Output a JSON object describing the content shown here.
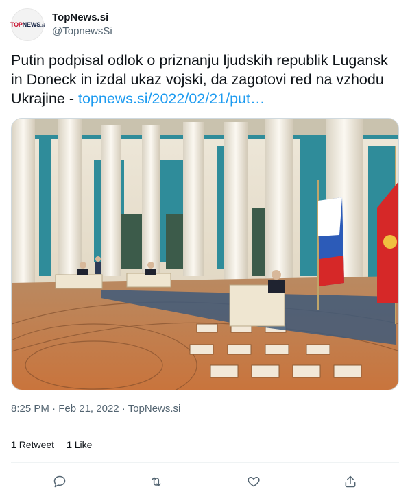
{
  "account": {
    "display_name": "TopNews.si",
    "handle": "@TopnewsSi",
    "avatar_brand_top": "TOP",
    "avatar_brand_news": "NEWS",
    "avatar_brand_si": ".si"
  },
  "tweet": {
    "text": "Putin podpisal odlok o priznanju ljudskih republik Lugansk in Doneck in izdal ukaz vojski, da zagotovi red na vzhodu Ukrajine - ",
    "link_text": "topnews.si/2022/02/21/put…",
    "media_description_icon": "photo"
  },
  "meta": {
    "time": "8:25 PM",
    "separator": " · ",
    "date": "Feb 21, 2022",
    "source": "TopNews.si"
  },
  "stats": {
    "retweets_count": "1",
    "retweets_label": "Retweet",
    "likes_count": "1",
    "likes_label": "Like"
  },
  "actions": {
    "reply_icon": "reply-icon",
    "retweet_icon": "retweet-icon",
    "like_icon": "like-icon",
    "share_icon": "share-icon"
  },
  "colors": {
    "link": "#1d9bf0",
    "secondary_text": "#536471",
    "primary_text": "#0f1419",
    "divider": "#eff3f4"
  }
}
